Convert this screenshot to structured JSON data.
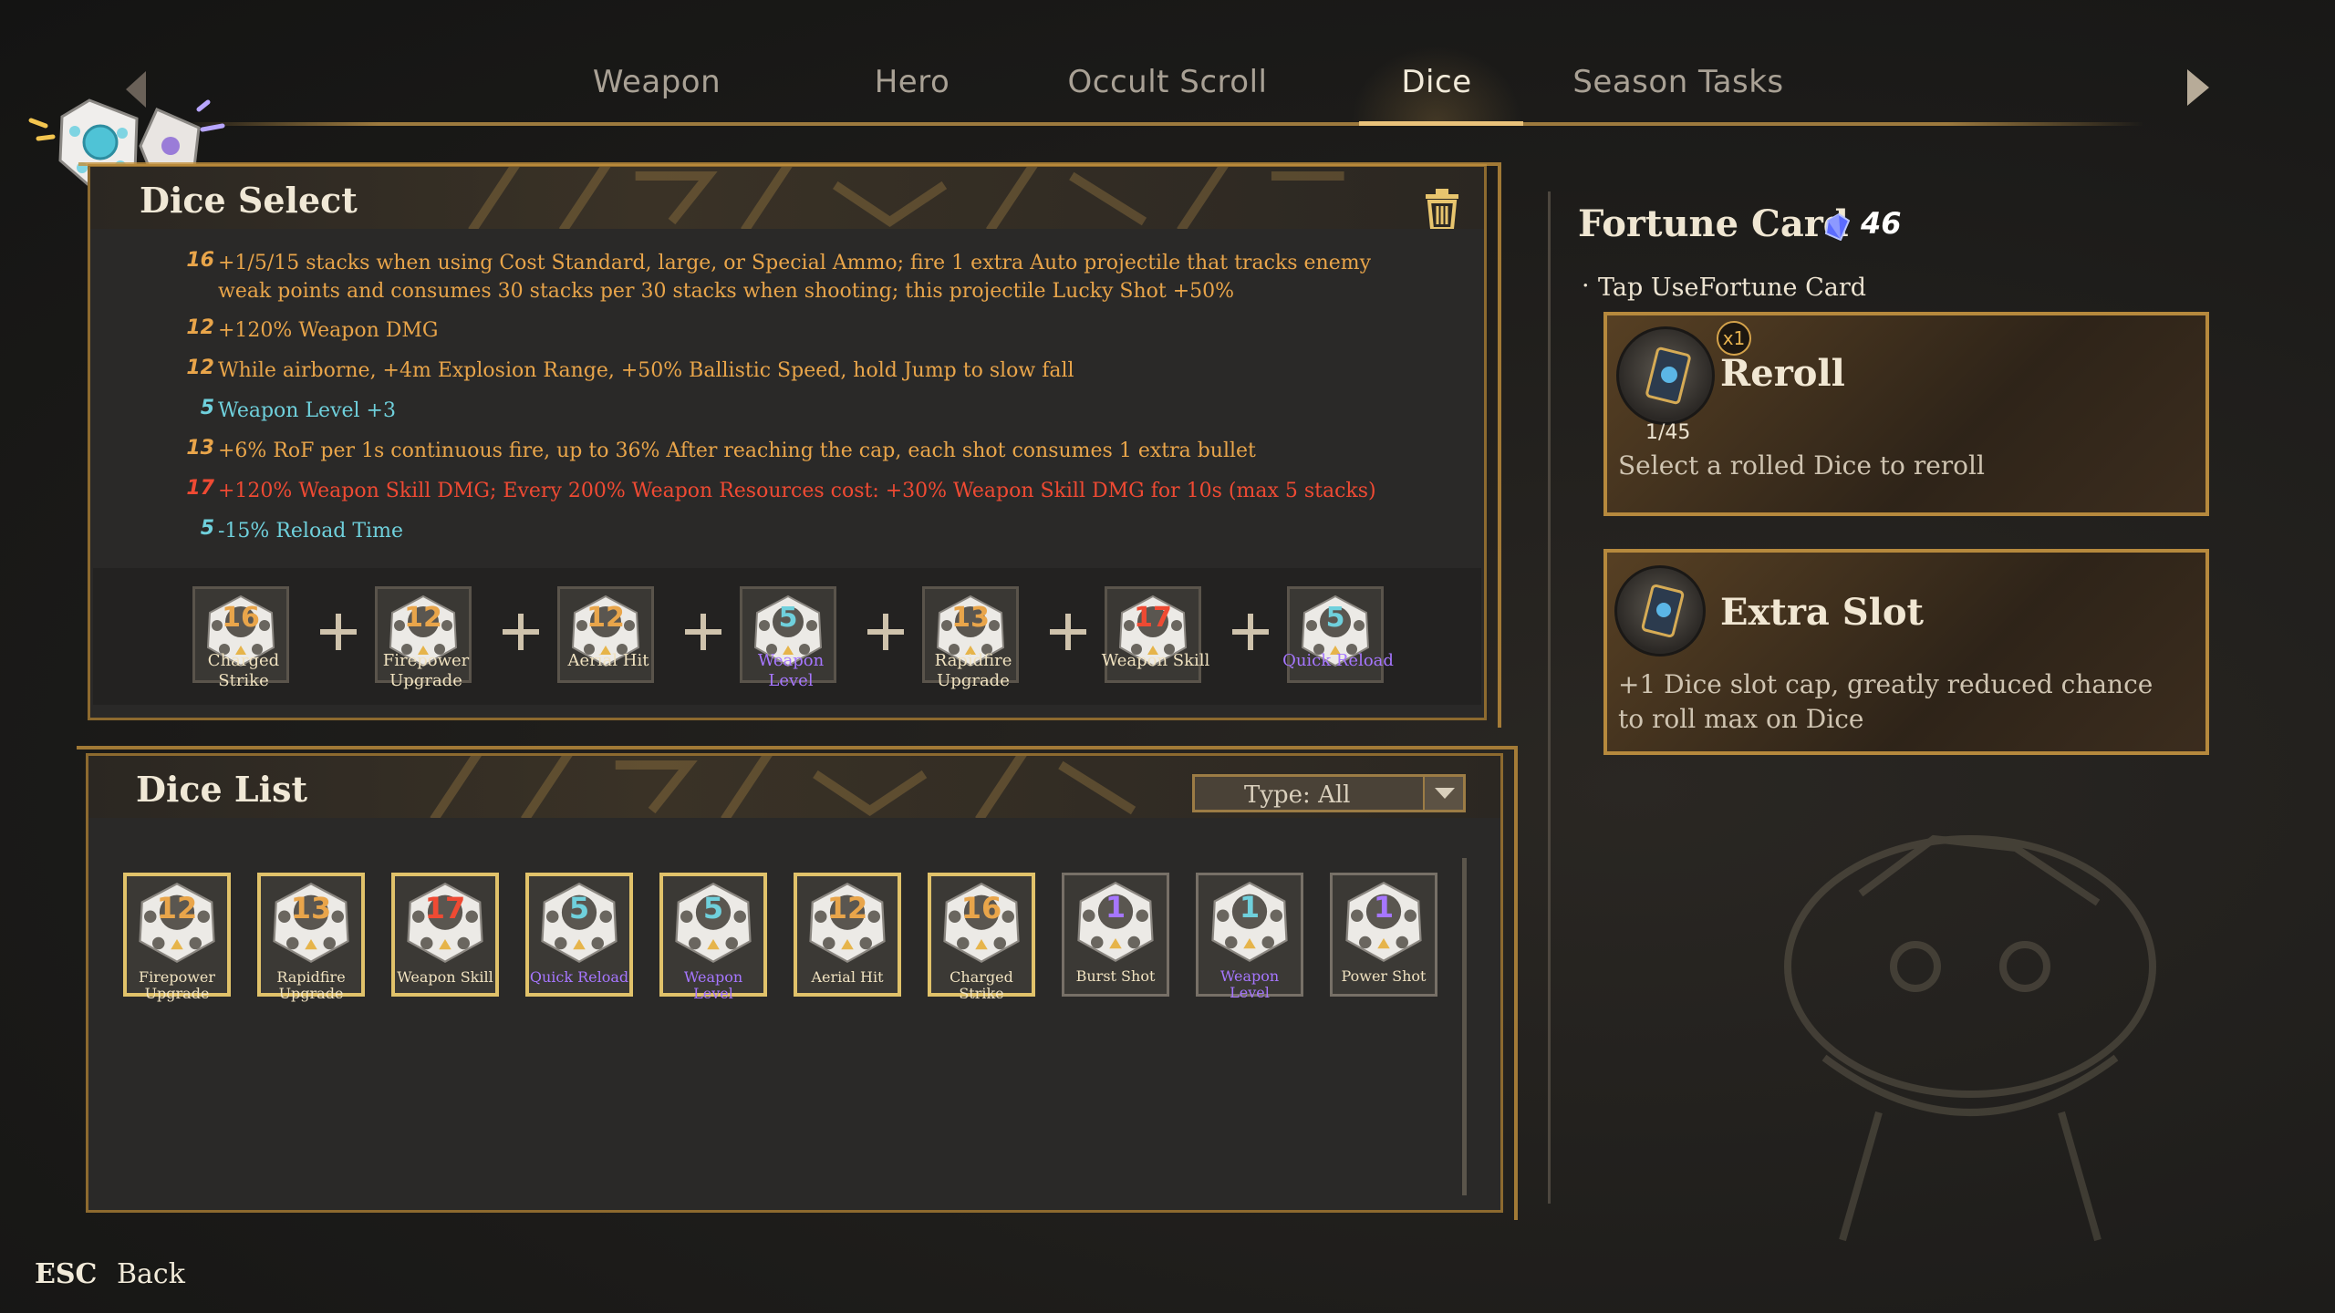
{
  "nav": {
    "tabs": [
      {
        "label": "Weapon",
        "active": false
      },
      {
        "label": "Hero",
        "active": false
      },
      {
        "label": "Occult Scroll",
        "active": false
      },
      {
        "label": "Dice",
        "active": true
      },
      {
        "label": "Season Tasks",
        "active": false
      }
    ],
    "left_arrow_icon": "chevron-left-icon",
    "right_arrow_icon": "chevron-right-icon"
  },
  "dice_select": {
    "title": "Dice Select",
    "clear_icon": "trash-icon",
    "effects": [
      {
        "level": "16",
        "color": "#e9a54a",
        "text": "+1/5/15 stacks when using Cost Standard, large, or Special Ammo; fire 1 extra Auto projectile that tracks enemy weak points and consumes 30 stacks per 30 stacks when shooting; this projectile Lucky Shot +50%"
      },
      {
        "level": "12",
        "color": "#e9a54a",
        "text": "+120% Weapon DMG"
      },
      {
        "level": "12",
        "color": "#e9a54a",
        "text": "While airborne, +4m Explosion Range, +50% Ballistic Speed, hold Jump to slow fall"
      },
      {
        "level": "5",
        "color": "#6fd0dc",
        "text": "Weapon Level +3"
      },
      {
        "level": "13",
        "color": "#e9a54a",
        "text": "+6% RoF per 1s continuous fire, up to 36% After reaching the cap, each shot consumes 1 extra bullet"
      },
      {
        "level": "17",
        "color": "#ef4a33",
        "text": "+120% Weapon Skill DMG; Every 200% Weapon Resources cost: +30% Weapon Skill DMG for 10s (max 5 stacks)"
      },
      {
        "level": "5",
        "color": "#6fd0dc",
        "text": "-15% Reload Time"
      }
    ],
    "combo": [
      {
        "value": "16",
        "name": "Charged Strike",
        "num_color": "#e9a54a",
        "name_color": "#f0e2c0"
      },
      {
        "value": "12",
        "name": "Firepower Upgrade",
        "num_color": "#e9a54a",
        "name_color": "#f0e2c0"
      },
      {
        "value": "12",
        "name": "Aerial Hit",
        "num_color": "#e9a54a",
        "name_color": "#f0e2c0"
      },
      {
        "value": "5",
        "name": "Weapon Level",
        "num_color": "#6fd0dc",
        "name_color": "#a676ff"
      },
      {
        "value": "13",
        "name": "Rapidfire Upgrade",
        "num_color": "#e9a54a",
        "name_color": "#f0e2c0"
      },
      {
        "value": "17",
        "name": "Weapon Skill",
        "num_color": "#ef4a33",
        "name_color": "#f0e2c0"
      },
      {
        "value": "5",
        "name": "Quick Reload",
        "num_color": "#6fd0dc",
        "name_color": "#a676ff"
      }
    ]
  },
  "dice_list": {
    "title": "Dice List",
    "filter": {
      "label": "Type: All"
    },
    "items": [
      {
        "value": "12",
        "name": "Firepower Upgrade",
        "num_color": "#e9a54a",
        "name_color": "#f0e2c0",
        "selected": true
      },
      {
        "value": "13",
        "name": "Rapidfire Upgrade",
        "num_color": "#e9a54a",
        "name_color": "#f0e2c0",
        "selected": true
      },
      {
        "value": "17",
        "name": "Weapon Skill",
        "num_color": "#ef4a33",
        "name_color": "#f0e2c0",
        "selected": true
      },
      {
        "value": "5",
        "name": "Quick Reload",
        "num_color": "#6fd0dc",
        "name_color": "#a676ff",
        "selected": true
      },
      {
        "value": "5",
        "name": "Weapon Level",
        "num_color": "#6fd0dc",
        "name_color": "#a676ff",
        "selected": true
      },
      {
        "value": "12",
        "name": "Aerial Hit",
        "num_color": "#e9a54a",
        "name_color": "#f0e2c0",
        "selected": true
      },
      {
        "value": "16",
        "name": "Charged Strike",
        "num_color": "#e9a54a",
        "name_color": "#f0e2c0",
        "selected": true
      },
      {
        "value": "1",
        "name": "Burst Shot",
        "num_color": "#a676ff",
        "name_color": "#f0e2c0",
        "selected": false
      },
      {
        "value": "1",
        "name": "Weapon Level",
        "num_color": "#6fd0dc",
        "name_color": "#a676ff",
        "selected": false
      },
      {
        "value": "1",
        "name": "Power Shot",
        "num_color": "#a676ff",
        "name_color": "#f0e2c0",
        "selected": false
      }
    ]
  },
  "fortune": {
    "title": "Fortune Card",
    "count": "46",
    "gem_icon": "crystal-icon",
    "hint": "Tap UseFortune Card",
    "cards": [
      {
        "title": "Reroll",
        "badge": "x1",
        "uses": "1/45",
        "desc": "Select a rolled Dice to reroll"
      },
      {
        "title": "Extra Slot",
        "desc": "+1 Dice slot cap, greatly reduced chance to roll max on Dice"
      }
    ]
  },
  "footer": {
    "key": "ESC",
    "label": "Back"
  },
  "colors": {
    "accent_gold": "#c3913d",
    "orange": "#e9a54a",
    "cyan": "#6fd0dc",
    "red": "#ef4a33",
    "purple": "#a676ff"
  }
}
